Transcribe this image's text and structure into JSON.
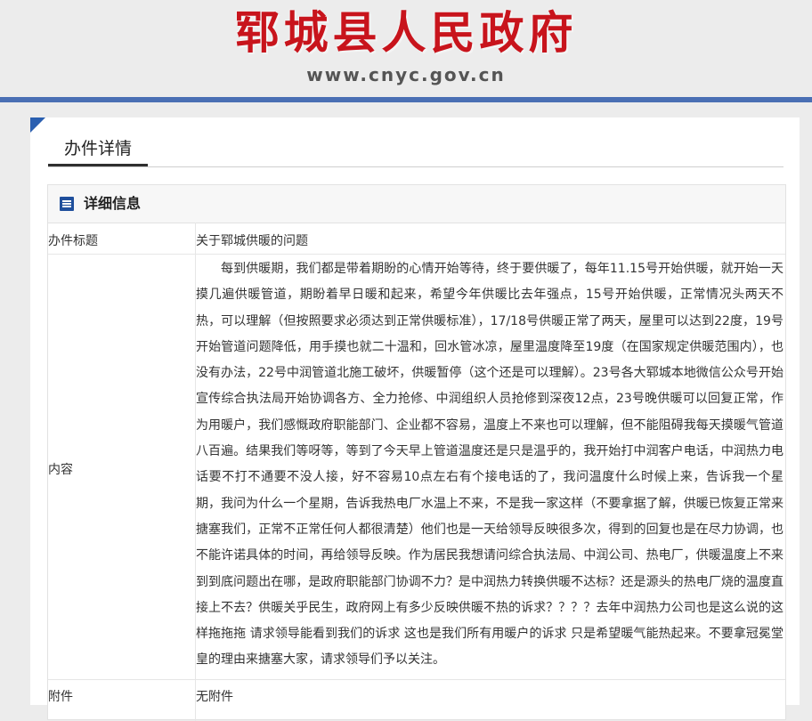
{
  "header": {
    "site_name": "郓城县人民政府",
    "site_url": "www.cnyc.gov.cn"
  },
  "page": {
    "tab_title": "办件详情"
  },
  "detail": {
    "section_title": "详细信息",
    "title_label": "办件标题",
    "title_value": "关于郓城供暖的问题",
    "content_label": "内容",
    "content_value": "每到供暖期，我们都是带着期盼的心情开始等待，终于要供暖了，每年11.15号开始供暖，就开始一天摸几遍供暖管道，期盼着早日暖和起来，希望今年供暖比去年强点，15号开始供暖，正常情况头两天不热，可以理解（但按照要求必须达到正常供暖标准），17/18号供暖正常了两天，屋里可以达到22度，19号开始管道问题降低，用手摸也就二十温和，回水管冰凉，屋里温度降至19度（在国家规定供暖范围内），也没有办法，22号中润管道北施工破坏，供暖暂停（这个还是可以理解）。23号各大郓城本地微信公众号开始宣传综合执法局开始协调各方、全力抢修、中润组织人员抢修到深夜12点，23号晚供暖可以回复正常，作为用暖户，我们感慨政府职能部门、企业都不容易，温度上不来也可以理解，但不能阻碍我每天摸暖气管道八百遍。结果我们等呀等，等到了今天早上管道温度还是只是温乎的，我开始打中润客户电话，中润热力电话要不打不通要不没人接，好不容易10点左右有个接电话的了，我问温度什么时候上来，告诉我一个星期，我问为什么一个星期，告诉我热电厂水温上不来，不是我一家这样（不要拿据了解，供暖已恢复正常来搪塞我们，正常不正常任何人都很清楚）他们也是一天给领导反映很多次，得到的回复也是在尽力协调，也不能许诺具体的时间，再给领导反映。作为居民我想请问综合执法局、中润公司、热电厂，供暖温度上不来到到底问题出在哪，是政府职能部门协调不力？是中润热力转换供暖不达标？还是源头的热电厂烧的温度直接上不去？供暖关乎民生，政府网上有多少反映供暖不热的诉求？？？？去年中润热力公司也是这么说的这样拖拖拖  请求领导能看到我们的诉求 这也是我们所有用暖户的诉求 只是希望暖气能热起来。不要拿冠冕堂皇的理由来搪塞大家，请求领导们予以关注。",
    "attachment_label": "附件",
    "attachment_value": "无附件"
  },
  "colors": {
    "brand_red": "#c8141c",
    "accent_blue": "#4a6fb4",
    "icon_blue": "#1f4f9c"
  },
  "icons": [
    "list-icon",
    "corner-triangle"
  ]
}
